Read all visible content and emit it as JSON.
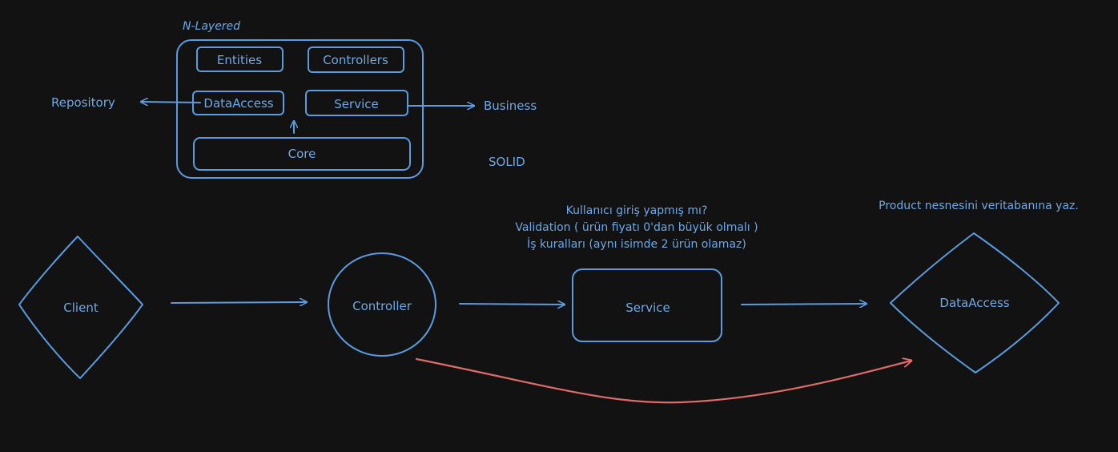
{
  "architecture": {
    "title": "N-Layered",
    "layers": {
      "entities": "Entities",
      "controllers": "Controllers",
      "data_access": "DataAccess",
      "service": "Service",
      "core": "Core"
    },
    "repository_label": "Repository",
    "business_label": "Business",
    "solid_label": "SOLID"
  },
  "flow": {
    "client": "Client",
    "controller": "Controller",
    "service": "Service",
    "data_access": "DataAccess",
    "service_notes": [
      "Kullanıcı giriş yapmış mı?",
      "Validation ( ürün fiyatı 0'dan büyük olmalı )",
      "İş kuralları (aynı isimde 2 ürün olamaz)"
    ],
    "data_access_note": "Product nesnesini veritabanına yaz."
  },
  "colors": {
    "background": "#121212",
    "shape_stroke": "#5b9be0",
    "text": "#6fa8e6",
    "bypass_arrow": "#e06a6a"
  }
}
